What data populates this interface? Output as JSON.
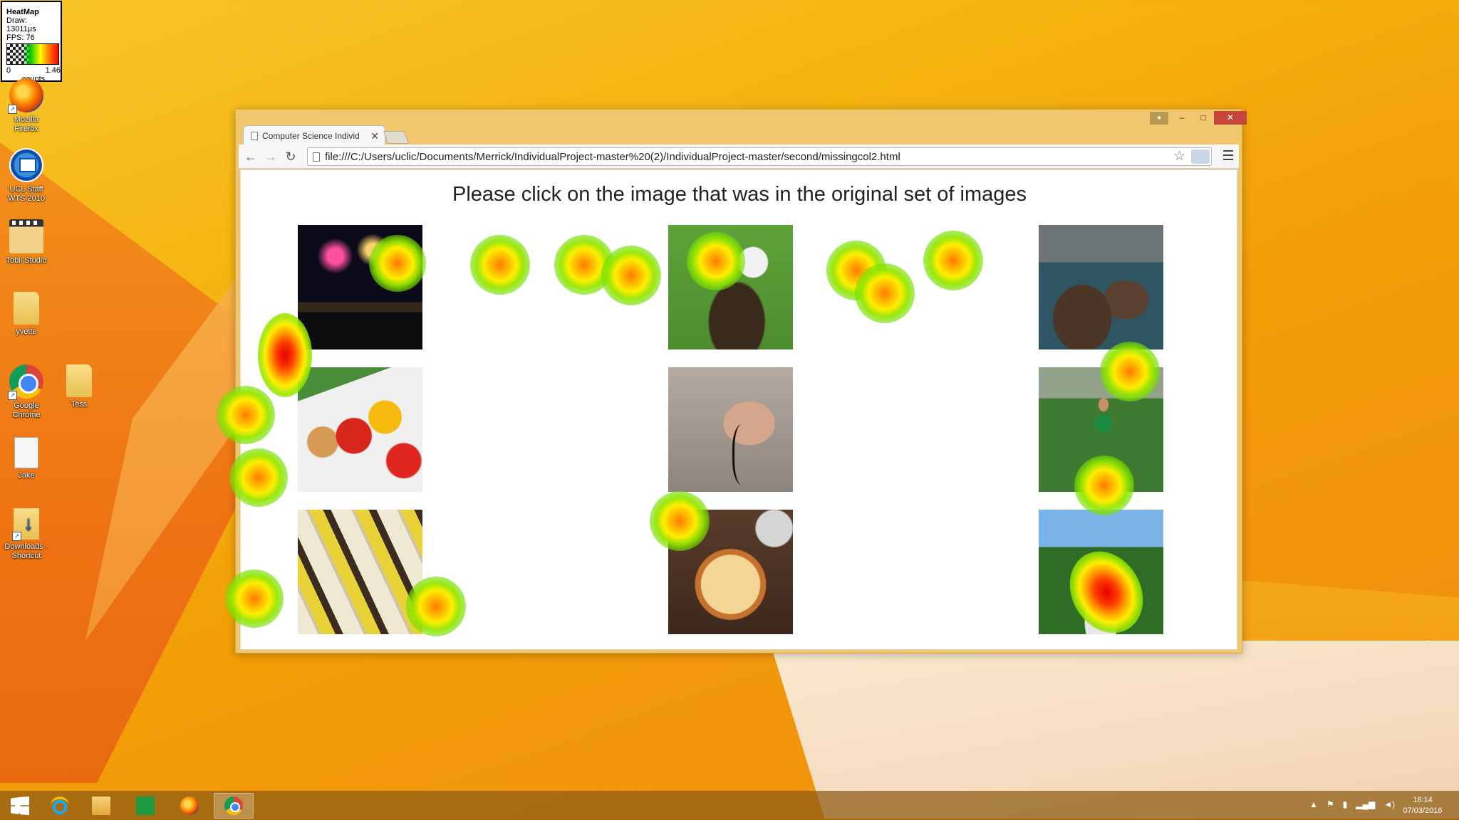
{
  "legend": {
    "title": "HeatMap",
    "draw": "Draw: 13011μs",
    "fps": "FPS: 76",
    "min": "0",
    "max": "1.46",
    "unit": "counts"
  },
  "desktop_icons": [
    {
      "label1": "Mozilla",
      "label2": "Firefox",
      "icon": "firefox-icon"
    },
    {
      "label1": "UCL Staff",
      "label2": "WTS 2010",
      "icon": "remote-desktop-icon"
    },
    {
      "label1": "Tobii Studio",
      "label2": "",
      "icon": "tobii-studio-icon"
    },
    {
      "label1": "yvette",
      "label2": "",
      "icon": "folder-icon"
    },
    {
      "label1": "Google",
      "label2": "Chrome",
      "icon": "chrome-icon"
    },
    {
      "label1": "Tess",
      "label2": "",
      "icon": "folder-icon"
    },
    {
      "label1": "Jake",
      "label2": "",
      "icon": "document-icon"
    },
    {
      "label1": "Downloads -",
      "label2": "Shortcut",
      "icon": "downloads-folder-icon"
    }
  ],
  "browser": {
    "tab_title": "Computer Science Individ",
    "url": "file:///C:/Users/uclic/Documents/Merrick/IndividualProject-master%20(2)/IndividualProject-master/second/missingcol2.html",
    "controls": {
      "minimize": "–",
      "maximize": "□",
      "close": "✕"
    }
  },
  "page": {
    "prompt": "Please click on the image that was in the original set of images",
    "images": [
      {
        "name": "fireworks"
      },
      {
        "name": "eagle"
      },
      {
        "name": "sea-stacks"
      },
      {
        "name": "vegetables"
      },
      {
        "name": "hand-with-cable"
      },
      {
        "name": "soccer-player"
      },
      {
        "name": "measuring-tape"
      },
      {
        "name": "pizza"
      },
      {
        "name": "park-stairs"
      }
    ]
  },
  "taskbar": {
    "apps": [
      "start-icon",
      "internet-explorer-icon",
      "file-explorer-icon",
      "store-icon",
      "firefox-icon",
      "chrome-icon"
    ],
    "active": "chrome-icon",
    "time": "16:14",
    "date": "07/03/2016"
  }
}
